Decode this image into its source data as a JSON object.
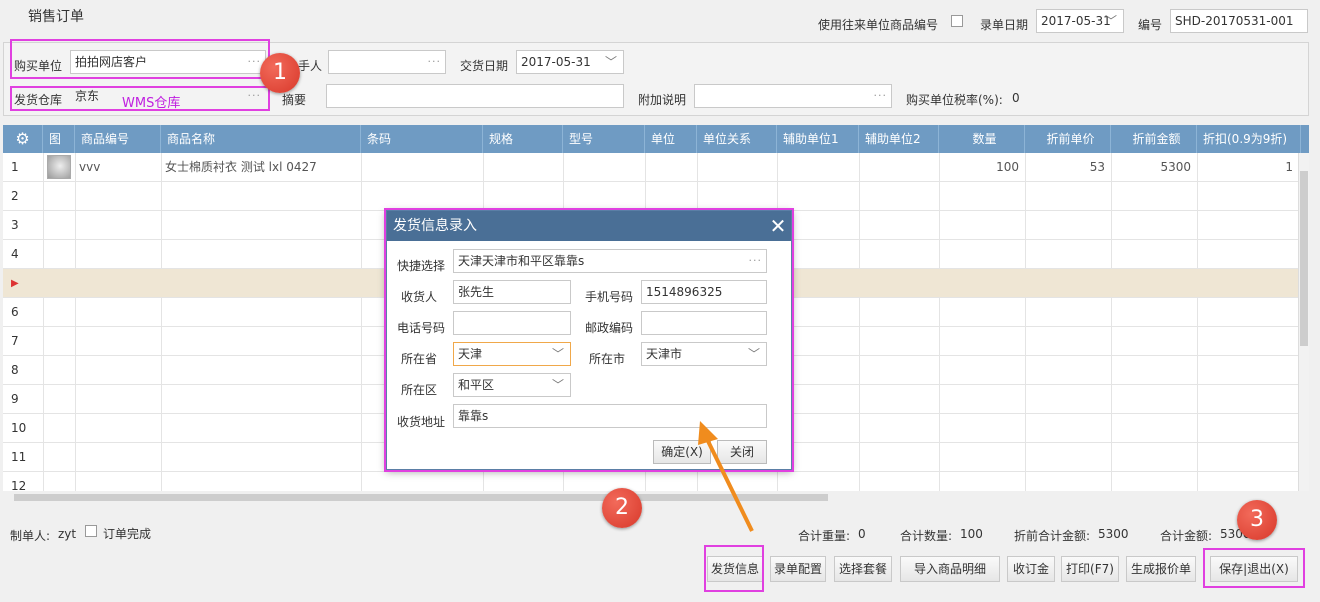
{
  "window": {
    "title": "销售订单"
  },
  "header": {
    "use_unit_code_label": "使用往来单位商品编号",
    "entry_date_label": "录单日期",
    "entry_date": "2017-05-31",
    "number_label": "编号",
    "number": "SHD-20170531-001"
  },
  "form": {
    "buyer_label": "购买单位",
    "buyer": "拍拍网店客户",
    "handler_label": "手人",
    "handler": "",
    "delivery_date_label": "交货日期",
    "delivery_date": "2017-05-31",
    "warehouse_label": "发货仓库",
    "warehouse": "京东",
    "warehouse_annotation": "WMS仓库",
    "summary_label": "摘要",
    "summary": "",
    "note_label": "附加说明",
    "note": "",
    "tax_label": "购买单位税率(%):",
    "tax_value": "0"
  },
  "grid": {
    "columns": [
      "图",
      "商品编号",
      "商品名称",
      "条码",
      "规格",
      "型号",
      "单位",
      "单位关系",
      "辅助单位1",
      "辅助单位2",
      "数量",
      "折前单价",
      "折前金额",
      "折扣(0.9为9折)"
    ],
    "rows": [
      {
        "n": "1",
        "code": "vvv",
        "name": "女士棉质衬衣 测试 lxl 0427",
        "qty": "100",
        "price": "53",
        "amount": "5300",
        "discount": "1"
      },
      {
        "n": "2"
      },
      {
        "n": "3"
      },
      {
        "n": "4"
      },
      {
        "n": "▶"
      },
      {
        "n": "6"
      },
      {
        "n": "7"
      },
      {
        "n": "8"
      },
      {
        "n": "9"
      },
      {
        "n": "10"
      },
      {
        "n": "11"
      },
      {
        "n": "12"
      }
    ]
  },
  "footer": {
    "maker_label": "制单人:",
    "maker": "zyt",
    "order_done_label": "订单完成",
    "total_weight_label": "合计重量:",
    "total_weight": "0",
    "total_qty_label": "合计数量:",
    "total_qty": "100",
    "pre_discount_total_label": "折前合计金额:",
    "pre_discount_total": "5300",
    "total_amount_label": "合计金额:",
    "total_amount": "5300"
  },
  "buttons": {
    "shipping_info": "发货信息",
    "entry_config": "录单配置",
    "select_package": "选择套餐",
    "import_details": "导入商品明细",
    "collect_deposit": "收订金",
    "print": "打印(F7)",
    "make_quote": "生成报价单",
    "save_exit": "保存|退出(X)"
  },
  "dialog": {
    "title": "发货信息录入",
    "quick_select_label": "快捷选择",
    "quick_select": "天津天津市和平区靠靠s",
    "receiver_label": "收货人",
    "receiver": "张先生",
    "mobile_label": "手机号码",
    "mobile": "1514896325",
    "phone_label": "电话号码",
    "phone": "",
    "postcode_label": "邮政编码",
    "postcode": "",
    "province_label": "所在省",
    "province": "天津",
    "city_label": "所在市",
    "city": "天津市",
    "district_label": "所在区",
    "district": "和平区",
    "address_label": "收货地址",
    "address": "靠靠s",
    "ok": "确定(X)",
    "close": "关闭"
  },
  "annotations": {
    "step1": "1",
    "step2": "2",
    "step3": "3"
  },
  "colors": {
    "header_blue": "#6f9bc3",
    "dialog_title": "#4a6f96",
    "highlight": "#e040e0",
    "badge": "#e04a3a",
    "arrow": "#f08c1e"
  }
}
